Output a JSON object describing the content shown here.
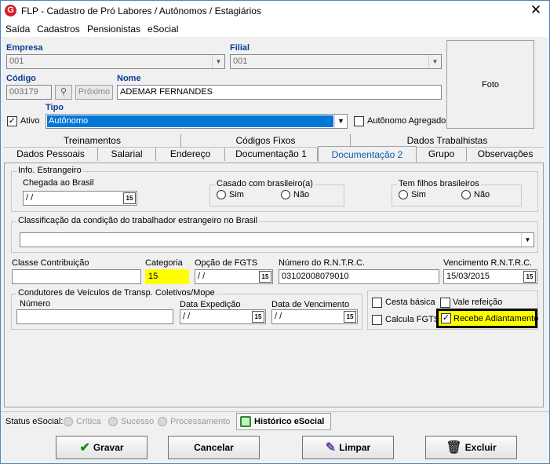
{
  "window": {
    "title": "FLP - Cadastro de Pró Labores / Autônomos / Estagiários",
    "close": "✕",
    "app_icon": "G"
  },
  "menu": [
    "Saída",
    "Cadastros",
    "Pensionistas",
    "eSocial"
  ],
  "header": {
    "empresa_label": "Empresa",
    "empresa_value": "001",
    "filial_label": "Filial",
    "filial_value": "001",
    "codigo_label": "Código",
    "codigo_value": "003179",
    "proximo_label": "Próximo",
    "nome_label": "Nome",
    "nome_value": "ADEMAR FERNANDES",
    "ativo_label": "Ativo",
    "ativo_checked": true,
    "tipo_label": "Tipo",
    "tipo_value": "Autônomo",
    "agregado_label": "Autônomo Agregado",
    "agregado_checked": false,
    "foto_label": "Foto"
  },
  "tabs_row1": [
    "Treinamentos",
    "Códigos Fixos",
    "Dados Trabalhistas"
  ],
  "tabs_row2": [
    "Dados Pessoais",
    "Salarial",
    "Endereço",
    "Documentação 1",
    "Documentação 2",
    "Grupo",
    "Observações"
  ],
  "active_tab": "Documentação 2",
  "estrangeiro": {
    "group_title": "Info. Estrangeiro",
    "chegada_label": "Chegada ao Brasil",
    "chegada_value": "/ /",
    "casado_title": "Casado com brasileiro(a)",
    "filhos_title": "Tem filhos brasileiros",
    "sim": "Sim",
    "nao": "Não"
  },
  "classificacao": {
    "title": "Classificação da condição do trabalhador estrangeiro no Brasil",
    "value": ""
  },
  "fields": {
    "classe_label": "Classe Contribuição",
    "classe_value": "",
    "categoria_label": "Categoria",
    "categoria_value": "15",
    "fgts_label": "Opção de FGTS",
    "fgts_value": "/ /",
    "rntrc_label": "Número do R.N.T.R.C.",
    "rntrc_value": "03102008079010",
    "venc_rntrc_label": "Vencimento R.N.T.R.C.",
    "venc_rntrc_value": "15/03/2015"
  },
  "condutores": {
    "title": "Condutores de Veículos de Transp. Coletivos/Mope",
    "numero_label": "Número",
    "numero_value": "",
    "expedicao_label": "Data Expedição",
    "expedicao_value": "/ /",
    "vencimento_label": "Data de Vencimento",
    "vencimento_value": "/ /"
  },
  "checks": {
    "cesta": "Cesta básica",
    "vale": "Vale refeição",
    "calcula": "Calcula FGTS",
    "adiantamento": "Recebe Adiantamento"
  },
  "calendar_glyph": "15",
  "status": {
    "label": "Status eSocial:",
    "critica": "Crítica",
    "sucesso": "Sucesso",
    "processamento": "Processamento",
    "historico": "Histórico eSocial"
  },
  "buttons": {
    "gravar": "Gravar",
    "cancelar": "Cancelar",
    "limpar": "Limpar",
    "excluir": "Excluir"
  },
  "colors": {
    "highlight_yellow": "#ffff00",
    "selection_blue": "#0078d7",
    "header_label_blue": "#0b3d91"
  }
}
